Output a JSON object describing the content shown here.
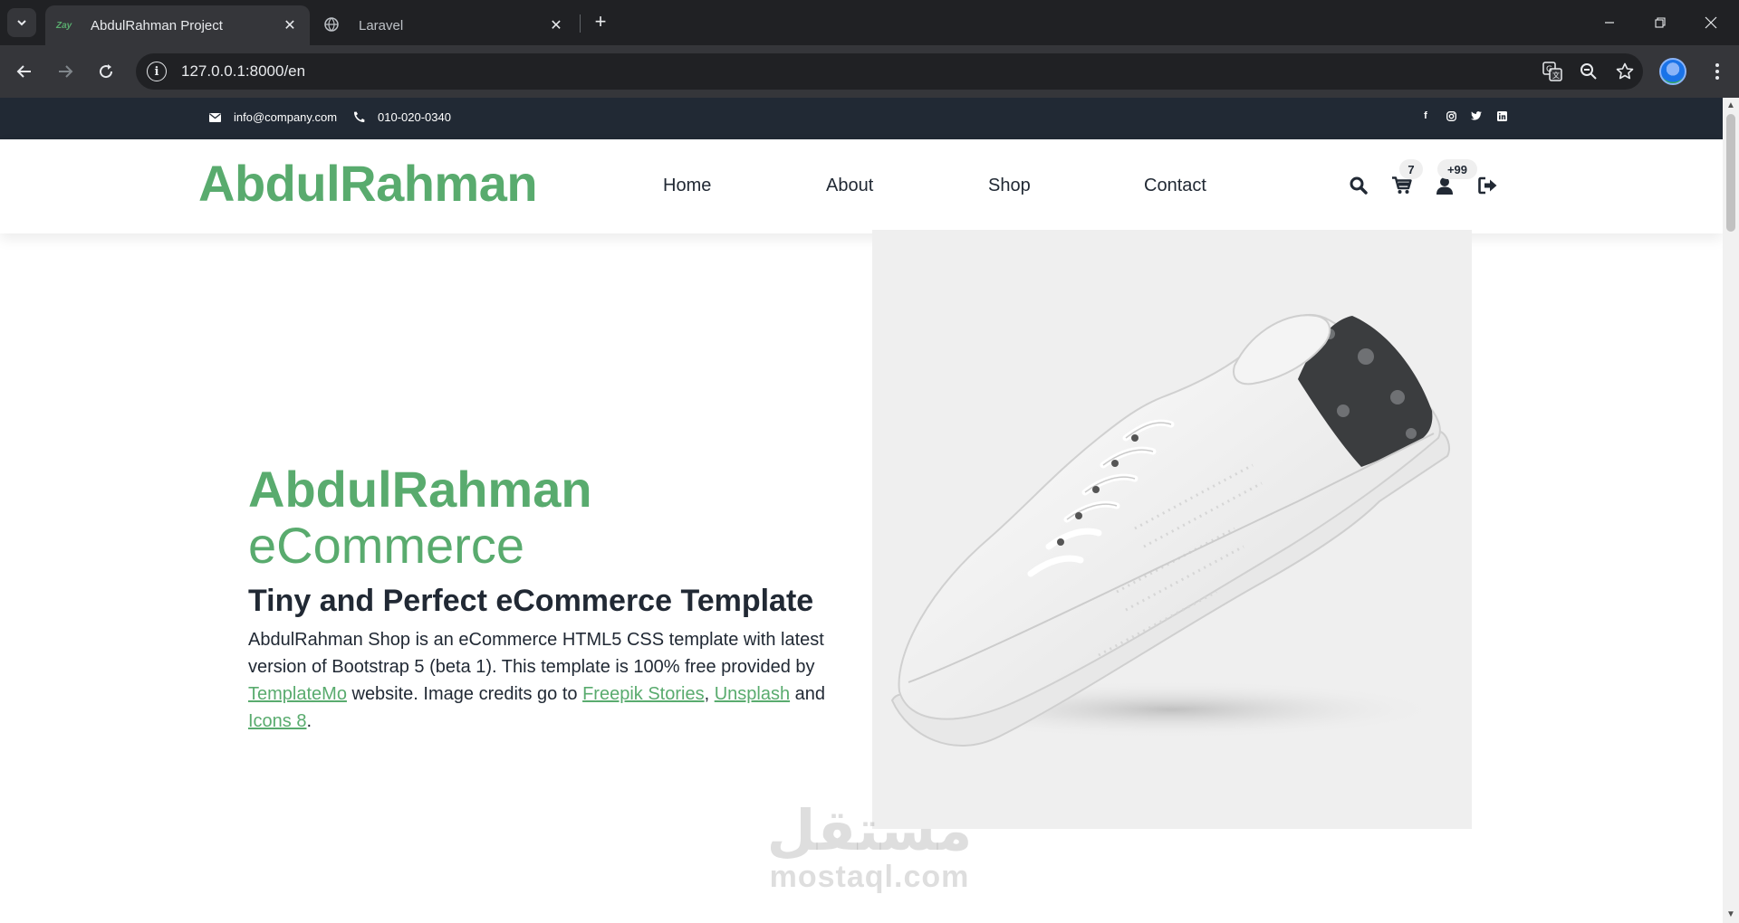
{
  "browser": {
    "tabs": [
      {
        "favicon": "Zay",
        "title": "AbdulRahman Project",
        "active": true
      },
      {
        "favicon": "globe-icon",
        "title": "Laravel",
        "active": false
      }
    ],
    "url": "127.0.0.1:8000/en"
  },
  "topbar": {
    "email": "info@company.com",
    "phone": "010-020-0340",
    "socials": [
      "facebook-icon",
      "instagram-icon",
      "twitter-icon",
      "linkedin-icon"
    ]
  },
  "navbar": {
    "logo": "AbdulRahman",
    "links": [
      "Home",
      "About",
      "Shop",
      "Contact"
    ],
    "cart_count": "7",
    "user_count": "+99"
  },
  "hero": {
    "title_bold": "AbdulRahman",
    "title_light": " eCommerce",
    "subtitle": "Tiny and Perfect eCommerce Template",
    "desc_1": "AbdulRahman Shop is an eCommerce HTML5 CSS template with latest version of Bootstrap 5 (beta 1). This template is 100% free provided by ",
    "link_templatemo": "TemplateMo",
    "desc_2": " website. Image credits go to ",
    "link_freepik": "Freepik Stories",
    "desc_3": ", ",
    "link_unsplash": "Unsplash",
    "desc_4": " and ",
    "link_icons8": "Icons 8",
    "desc_5": "."
  },
  "watermark": {
    "arabic": "مستقل",
    "latin": "mostaql.com"
  },
  "colors": {
    "brand": "#59ab6e",
    "dark": "#212934",
    "chrome": "#202124"
  }
}
